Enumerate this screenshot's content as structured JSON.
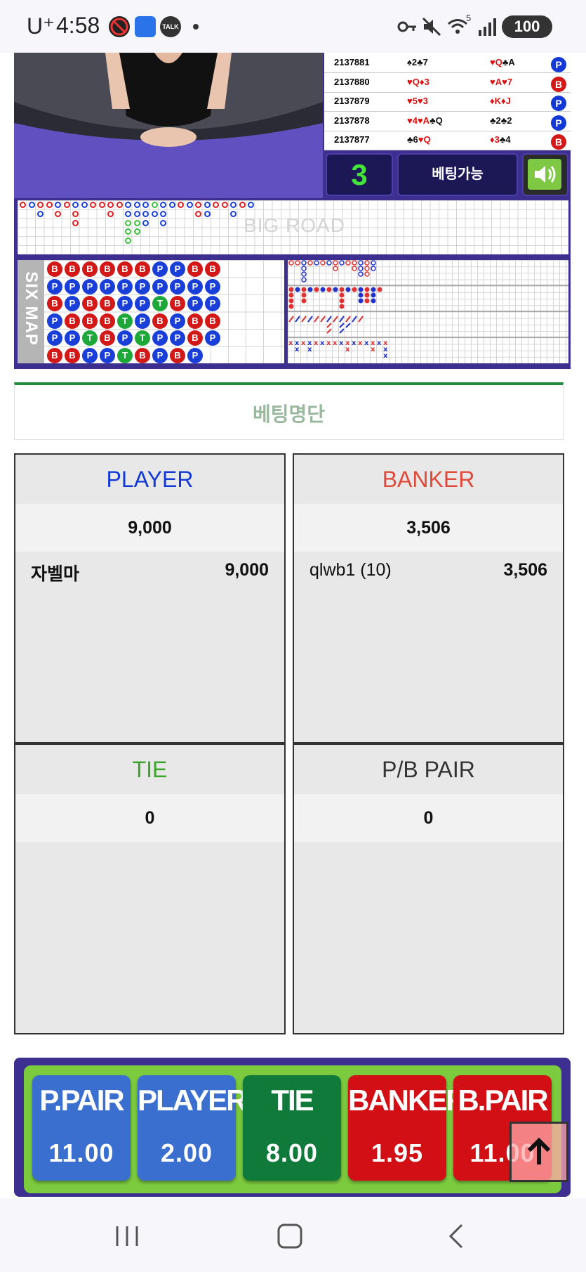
{
  "status_bar": {
    "carrier": "U⁺",
    "time": "4:58",
    "battery": "100",
    "notification_icons": [
      "no-smoking-icon",
      "app-icon",
      "talk-icon",
      "dot-icon"
    ],
    "system_icons": [
      "key-icon",
      "mute-icon",
      "wifi-icon",
      "signal-icon"
    ],
    "talk_label": "TALK",
    "wifi_label": "5"
  },
  "results": {
    "rows": [
      {
        "id": "2137881",
        "player": "♠2♣7",
        "banker": "♥Q♣A",
        "winner": "P"
      },
      {
        "id": "2137880",
        "player": "♥Q♦3",
        "banker": "♥A♥7",
        "winner": "B"
      },
      {
        "id": "2137879",
        "player": "♥5♥3",
        "banker": "♦K♦J",
        "winner": "P"
      },
      {
        "id": "2137878",
        "player": "♥4♥A♣Q",
        "banker": "♣2♣2",
        "winner": "P"
      },
      {
        "id": "2137877",
        "player": "♣6♥Q",
        "banker": "♦3♣4",
        "winner": "B"
      }
    ]
  },
  "controls": {
    "countdown": "3",
    "status": "베팅가능"
  },
  "roads": {
    "big_road_watermark": "BIG ROAD",
    "six_map_label": "SIX MAP",
    "six_map_columns": [
      [
        "B",
        "P",
        "B",
        "P",
        "P",
        "B"
      ],
      [
        "B",
        "P",
        "P",
        "B",
        "P",
        "B"
      ],
      [
        "B",
        "P",
        "B",
        "B",
        "T",
        "P"
      ],
      [
        "B",
        "P",
        "B",
        "B",
        "B",
        "P"
      ],
      [
        "B",
        "P",
        "P",
        "T",
        "P",
        "T"
      ],
      [
        "B",
        "P",
        "P",
        "P",
        "T",
        "B"
      ],
      [
        "P",
        "P",
        "T",
        "B",
        "P",
        "P"
      ],
      [
        "P",
        "P",
        "B",
        "P",
        "P",
        "B"
      ],
      [
        "B",
        "P",
        "P",
        "B",
        "B",
        "P"
      ],
      [
        "B",
        "P",
        "P",
        "B",
        "P",
        ""
      ]
    ],
    "big_road_columns": [
      [
        "B"
      ],
      [
        "P"
      ],
      [
        "B",
        "P"
      ],
      [
        "B"
      ],
      [
        "P",
        "B"
      ],
      [
        "B"
      ],
      [
        "P",
        "B",
        "B"
      ],
      [
        "P"
      ],
      [
        "B"
      ],
      [
        "B"
      ],
      [
        "B",
        "B"
      ],
      [
        "B"
      ],
      [
        "P",
        "P",
        "T",
        "T",
        "T"
      ],
      [
        "P",
        "P",
        "T",
        "T"
      ],
      [
        "P",
        "P",
        "P"
      ],
      [
        "T",
        "P"
      ],
      [
        "P",
        "P",
        "P"
      ],
      [
        "P"
      ],
      [
        "B"
      ],
      [
        "P"
      ],
      [
        "B",
        "B"
      ],
      [
        "P",
        "P"
      ],
      [
        "B"
      ],
      [
        "B"
      ],
      [
        "P",
        "P"
      ],
      [
        "B"
      ],
      [
        "P"
      ]
    ]
  },
  "betting_list": {
    "title": "베팅명단",
    "player": {
      "label": "PLAYER",
      "total": "9,000",
      "entries": [
        {
          "name": "자벨마",
          "amount": "9,000"
        }
      ]
    },
    "banker": {
      "label": "BANKER",
      "total": "3,506",
      "entries": [
        {
          "name": "qlwb1 (10)",
          "amount": "3,506"
        }
      ]
    },
    "tie": {
      "label": "TIE",
      "total": "0"
    },
    "pair": {
      "label": "P/B PAIR",
      "total": "0"
    }
  },
  "bets": [
    {
      "label": "P.PAIR",
      "odds": "11.00",
      "color": "#3a6fcf"
    },
    {
      "label": "PLAYER",
      "odds": "2.00",
      "color": "#3a6fcf"
    },
    {
      "label": "TIE",
      "odds": "8.00",
      "color": "#0f7a3a"
    },
    {
      "label": "BANKER",
      "odds": "1.95",
      "color": "#d10f14"
    },
    {
      "label": "B.PAIR",
      "odds": "11.00",
      "color": "#d10f14"
    }
  ],
  "colors": {
    "player": "#1239d6",
    "banker": "#e04a3a",
    "tie": "#3aa52a",
    "pair": "#333333"
  },
  "scroll_top_icon": "arrow-up-icon",
  "nav_icons": [
    "recent-apps-icon",
    "home-icon",
    "back-icon"
  ]
}
